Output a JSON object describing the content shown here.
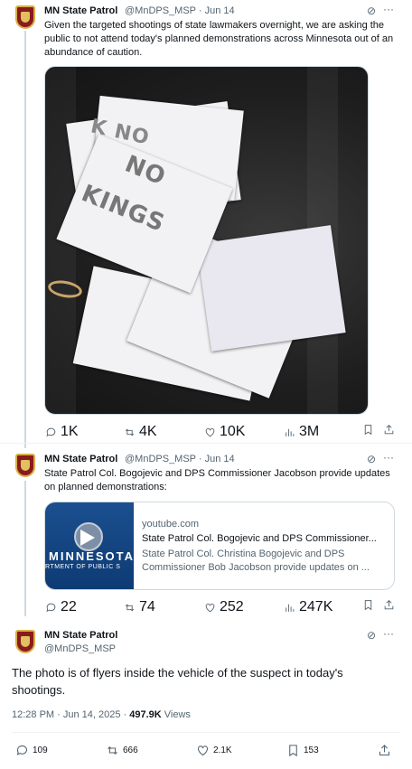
{
  "tweets": [
    {
      "name": "MN State Patrol",
      "handle_meta": "@MnDPS_MSP · Jun 14",
      "text": "Given the targeted shootings of state lawmakers overnight, we are asking the public to not attend today's planned demonstrations across Minnesota out of an abundance of caution.",
      "image": {
        "flyer_line1": "NO",
        "flyer_line2": "KINGS",
        "flyer_bg_text": "K  NO"
      },
      "metrics": {
        "replies": "1K",
        "reposts": "4K",
        "likes": "10K",
        "views": "3M"
      }
    },
    {
      "name": "MN State Patrol",
      "handle_meta": "@MnDPS_MSP · Jun 14",
      "text": "State Patrol Col. Bogojevic and DPS Commissioner Jacobson provide updates on planned demonstrations:",
      "card": {
        "thumb_line1": "MINNESOTA",
        "thumb_line2": "RTMENT OF PUBLIC S",
        "domain": "youtube.com",
        "title": "State Patrol Col. Bogojevic and DPS Commissioner...",
        "description": "State Patrol Col. Christina Bogojevic and DPS Commissioner Bob Jacobson provide updates on ..."
      },
      "metrics": {
        "replies": "22",
        "reposts": "74",
        "likes": "252",
        "views": "247K"
      }
    }
  ],
  "main_tweet": {
    "name": "MN State Patrol",
    "handle": "@MnDPS_MSP",
    "text": "The photo is of flyers inside the vehicle of the suspect in today's shootings.",
    "timestamp": "12:28 PM · Jun 14, 2025 · ",
    "views_count": "497.9K",
    "views_label": " Views",
    "metrics": {
      "replies": "109",
      "reposts": "666",
      "likes": "2.1K",
      "bookmarks": "153"
    }
  },
  "icons": {
    "grok": "grok-icon",
    "more": "more-icon",
    "reply": "reply-icon",
    "repost": "repost-icon",
    "like": "like-icon",
    "views": "views-icon",
    "bookmark": "bookmark-icon",
    "share": "share-icon"
  },
  "colors": {
    "text": "#0f1419",
    "secondary": "#536471",
    "border": "#cfd9de",
    "avatar_red": "#8b1a1a"
  }
}
